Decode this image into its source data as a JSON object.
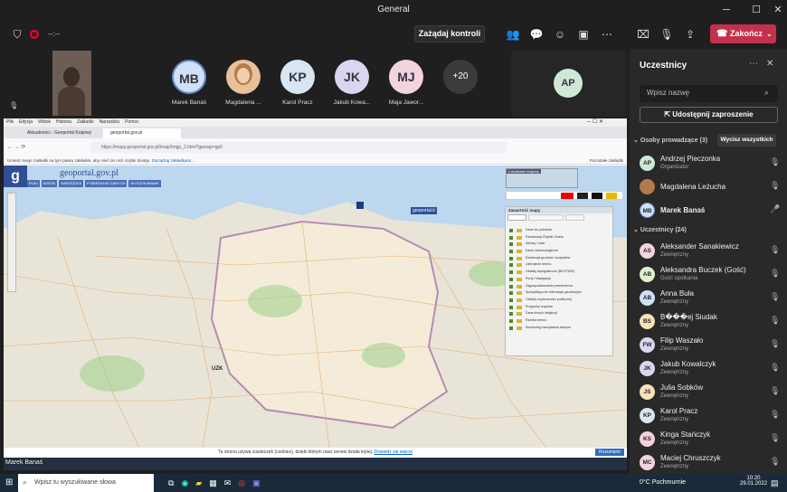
{
  "window": {
    "title": "General"
  },
  "toolbar": {
    "timer": "--:--",
    "control_label": "Zażądaj kontroli",
    "leave_label": "Zakończ"
  },
  "gallery": {
    "tiles": [
      {
        "initials": "MB",
        "name": "Marek Banaś",
        "bg": "#cfe0f7"
      },
      {
        "initials": "",
        "name": "Magdalena ...",
        "bg": "#f0c9a9"
      },
      {
        "initials": "KP",
        "name": "Karol Pracz",
        "bg": "#d7e6f2"
      },
      {
        "initials": "JK",
        "name": "Jakub Kowa...",
        "bg": "#dcd5f0"
      },
      {
        "initials": "MJ",
        "name": "Maja Jawor...",
        "bg": "#f3d3dd"
      }
    ],
    "overflow": "+20",
    "side_tile": {
      "initials": "AP",
      "bg": "#cfe8d6"
    }
  },
  "panel": {
    "title": "Uczestnicy",
    "search_placeholder": "Wpisz nazwę",
    "share_label": "Udostępnij zaproszenie",
    "presenters_label": "Osoby prowadzące (3)",
    "mute_all": "Wycisz wszystkich",
    "presenters": [
      {
        "initials": "AP",
        "name": "Andrzej Pieczonka",
        "role": "Organizator",
        "bg": "#cfe8d6"
      },
      {
        "initials": "",
        "name": "Magdalena Leżucha",
        "role": "",
        "bg": "#f0c9a9"
      },
      {
        "initials": "MB",
        "name": "Marek Banaś",
        "role": "",
        "bg": "#cfe0f7"
      }
    ],
    "attendees_label": "Uczestnicy (24)",
    "attendees": [
      {
        "initials": "AS",
        "name": "Aleksander Sanakiewicz",
        "role": "Zewnętrzny",
        "bg": "#f3d3dd"
      },
      {
        "initials": "AB",
        "name": "Aleksandra Buczek (Gość)",
        "role": "Gość spotkania",
        "bg": "#e3f0cf"
      },
      {
        "initials": "AB",
        "name": "Anna Buła",
        "role": "Zewnętrzny",
        "bg": "#cfe0f7"
      },
      {
        "initials": "BS",
        "name": "B���ej Siudak",
        "role": "Zewnętrzny",
        "bg": "#f7e2b8"
      },
      {
        "initials": "FW",
        "name": "Filip Waszało",
        "role": "Zewnętrzny",
        "bg": "#dcd5f0"
      },
      {
        "initials": "JK",
        "name": "Jakub Kowalczyk",
        "role": "Zewnętrzny",
        "bg": "#dcd5f0"
      },
      {
        "initials": "JS",
        "name": "Julia Sobków",
        "role": "Zewnętrzny",
        "bg": "#f7e2b8"
      },
      {
        "initials": "KP",
        "name": "Karol Pracz",
        "role": "Zewnętrzny",
        "bg": "#d7e6f2"
      },
      {
        "initials": "KS",
        "name": "Kinga Stańczyk",
        "role": "Zewnętrzny",
        "bg": "#f3d3dd"
      },
      {
        "initials": "MC",
        "name": "Maciej Chruszczyk",
        "role": "Zewnętrzny",
        "bg": "#f3d3dd"
      }
    ]
  },
  "shared": {
    "presenter": "Marek Banaś",
    "browser_menu": [
      "Plik",
      "Edycja",
      "Widok",
      "Historia",
      "Zakładki",
      "Narzędzia",
      "Pomoc"
    ],
    "tabs": [
      "Aktualności - Geoportal Krajowy",
      "geoportal.gov.pl"
    ],
    "url": "https://mapy.geoportal.gov.pl/imap/Imgp_2.html?gpmap=gp0",
    "bookmark_hint": "Umieść swoje zakładki na tym pasku zakładek, aby mieć do nich szybki dostęp.",
    "bookmark_link": "Zarządzaj zakładkami...",
    "bookmark_other": "Pozostałe zakładki",
    "site_logo": "geoportal.gov.pl",
    "site_menu": [
      "PLIKI",
      "WIDOK",
      "NARZĘDZIA",
      "POBIERANIE DANYCH",
      "WYSZUKIWANIE"
    ],
    "map_labels": [
      "UZK",
      "geoportal.it"
    ],
    "overview_title": "Lokalizator krajowy",
    "content_title": "Zawartość mapy",
    "content_tabs": [
      "Warstwy",
      "Dostępne warstwy",
      "Legenda"
    ],
    "layers": [
      "Dane do pobrania",
      "Państwowy Rejestr Granic",
      "Adresy i ulice",
      "Dane meteorologiczne",
      "Ewidencja gruntów i budynków",
      "Uzbrojenie terenu",
      "Obiekty topograficzne (BDOT500)",
      "Porty i Nawigacja",
      "Zagospodarowanie przestrzenne",
      "Specjalistyczne informacje geodezyjne",
      "Obiekty użyteczności publicznej",
      "Programy rządowe",
      "Dane innych instytucji",
      "Rzeźba terenu",
      "Monitoring zarządzania danymi"
    ],
    "cookie_text": "Ta strona używa ciasteczek (cookies), dzięki którym nasz serwis działa lepiej.",
    "cookie_link": "Dowiedz się więcej",
    "cookie_btn": "Rozumiem"
  },
  "taskbar": {
    "search": "Wpisz tu wyszukiwane słowa",
    "weather": "0°C Pochmurnie",
    "time": "10:20",
    "date": "29.01.2022"
  }
}
